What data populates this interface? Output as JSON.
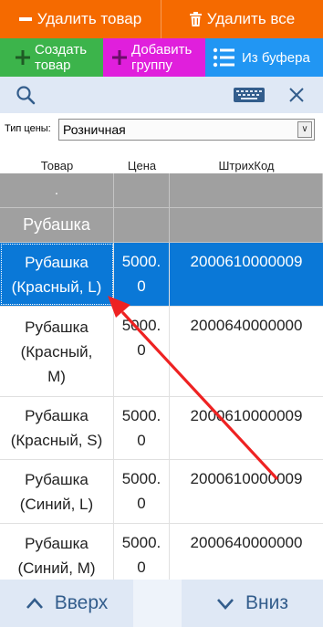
{
  "toolbar": {
    "delete_item_label": "Удалить товар",
    "delete_all_label": "Удалить все",
    "create_item_label": "Создать\nтовар",
    "add_group_label": "Добавить\nгруппу",
    "from_buffer_label": "Из буфера"
  },
  "price": {
    "label": "Тип цены:",
    "selected": "Розничная"
  },
  "columns": {
    "item": "Товар",
    "price": "Цена",
    "barcode": "ШтрихКод"
  },
  "rows": [
    {
      "type": "group",
      "name": "."
    },
    {
      "type": "group",
      "name": "Рубашка"
    },
    {
      "type": "item",
      "name_lines": [
        "Рубашка",
        "(Красный, L)"
      ],
      "price_lines": [
        "5000.",
        "0"
      ],
      "barcode": "2000610000009",
      "selected": true
    },
    {
      "type": "item",
      "name_lines": [
        "Рубашка",
        "(Красный,",
        "M)"
      ],
      "price_lines": [
        "5000.",
        "0"
      ],
      "barcode": "2000640000000"
    },
    {
      "type": "item",
      "name_lines": [
        "Рубашка",
        "(Красный, S)"
      ],
      "price_lines": [
        "5000.",
        "0"
      ],
      "barcode": "2000610000009"
    },
    {
      "type": "item",
      "name_lines": [
        "Рубашка",
        "(Синий, L)"
      ],
      "price_lines": [
        "5000.",
        "0"
      ],
      "barcode": "2000610000009"
    },
    {
      "type": "item",
      "name_lines": [
        "Рубашка",
        "(Синий, M)"
      ],
      "price_lines": [
        "5000.",
        "0"
      ],
      "barcode": "2000640000000"
    }
  ],
  "nav": {
    "up_label": "Вверх",
    "down_label": "Вниз"
  },
  "colors": {
    "orange": "#f56a00",
    "green": "#3cb44b",
    "magenta": "#e01fdc",
    "blue": "#2196f3",
    "selected": "#0a78d7",
    "group_gray": "#a0a0a0",
    "annotation_arrow": "#ee2222"
  },
  "icons": [
    "minus-icon",
    "trash-icon",
    "plus-icon",
    "list-icon",
    "search-icon",
    "keyboard-icon",
    "close-icon",
    "chevron-up-icon",
    "chevron-down-icon"
  ]
}
